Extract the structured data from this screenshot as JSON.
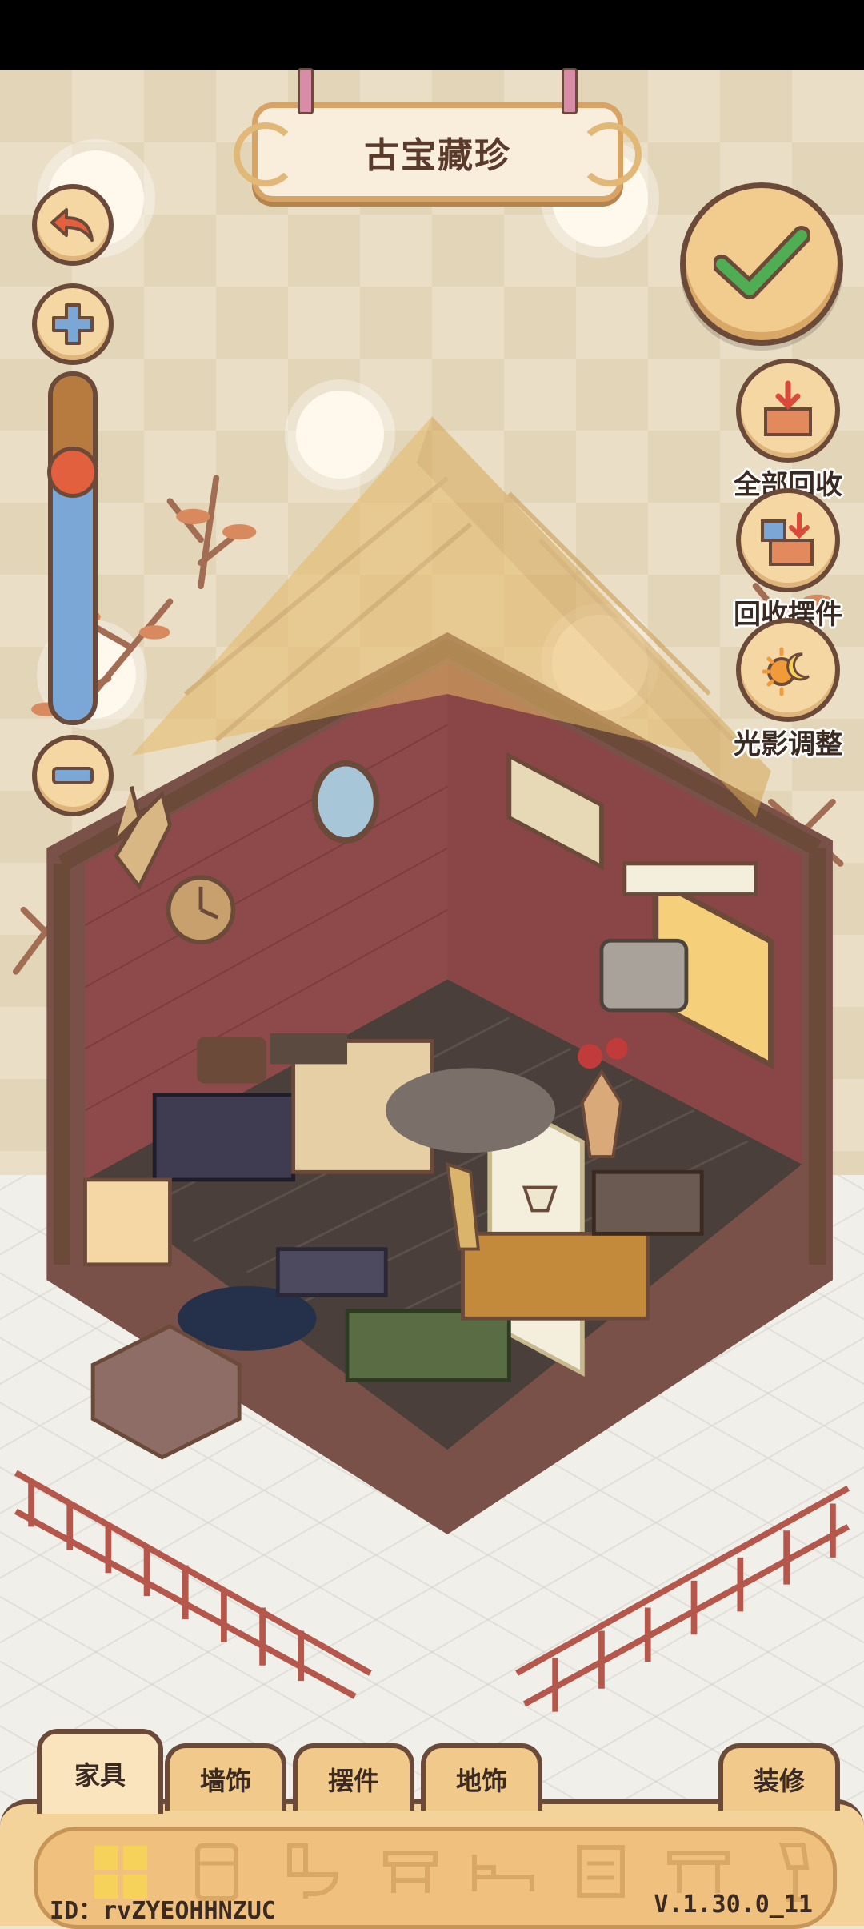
{
  "title": "古宝藏珍",
  "zoom_level": 0.28,
  "actions": [
    {
      "label": "全部回收",
      "icon": "recycle-all-icon"
    },
    {
      "label": "回收摆件",
      "icon": "recycle-ornament-icon"
    },
    {
      "label": "光影调整",
      "icon": "light-adjust-icon"
    }
  ],
  "tabs": [
    {
      "label": "家具",
      "active": true
    },
    {
      "label": "墙饰",
      "active": false
    },
    {
      "label": "摆件",
      "active": false
    },
    {
      "label": "地饰",
      "active": false
    },
    {
      "label": "装修",
      "active": false
    }
  ],
  "categories": [
    "all-icon",
    "fridge-icon",
    "toilet-icon",
    "stool-icon",
    "bed-icon",
    "cabinet-icon",
    "table-icon",
    "lamp-icon"
  ],
  "footer": {
    "id_text": "ID：rvZYEOHHNZUC",
    "version": "V.1.30.0_11"
  },
  "colors": {
    "accent": "#f5d7a4",
    "outline": "#6b4a3a",
    "check": "#4fae54",
    "wall": "#8e4a4a"
  }
}
